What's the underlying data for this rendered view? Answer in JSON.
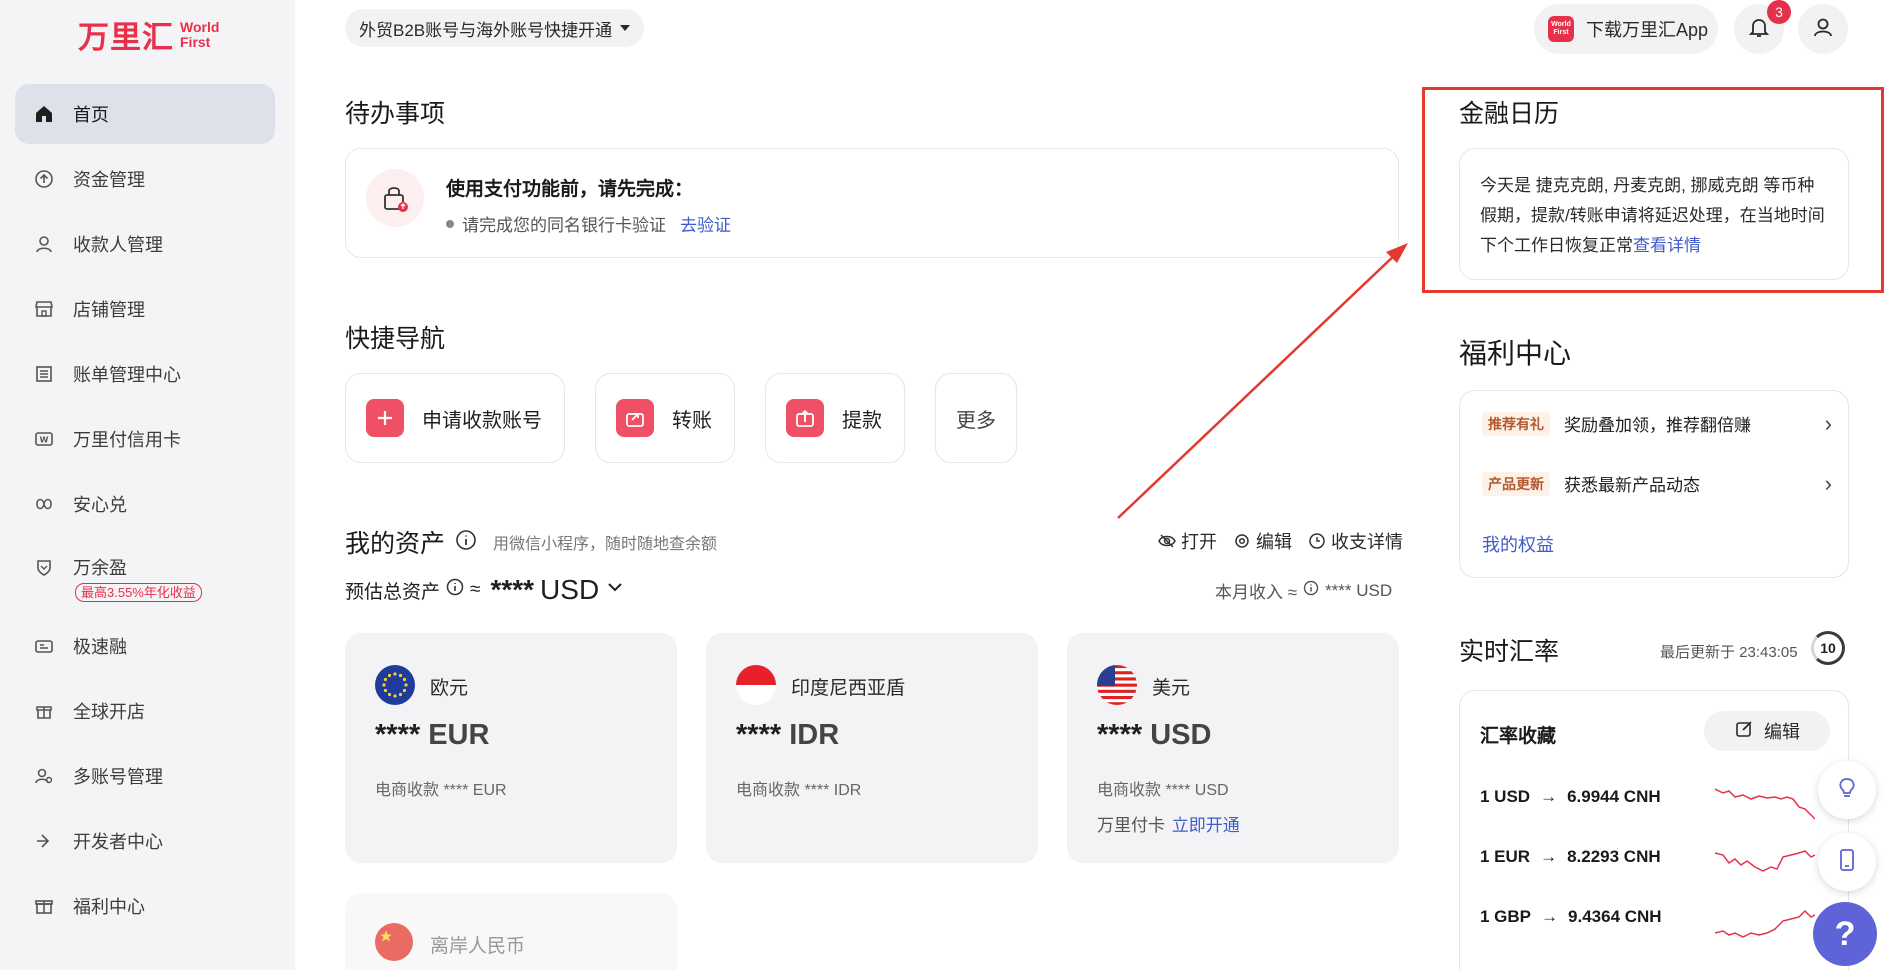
{
  "logo": {
    "cn": "万里汇",
    "en_line1": "World",
    "en_line2": "First"
  },
  "sidebar": {
    "items": [
      {
        "label": "首页",
        "icon": "home-icon",
        "active": true
      },
      {
        "label": "资金管理",
        "icon": "fund-icon"
      },
      {
        "label": "收款人管理",
        "icon": "payee-icon"
      },
      {
        "label": "店铺管理",
        "icon": "store-icon"
      },
      {
        "label": "账单管理中心",
        "icon": "bill-icon"
      },
      {
        "label": "万里付信用卡",
        "icon": "credit-card-icon"
      },
      {
        "label": "安心兑",
        "icon": "exchange-icon"
      },
      {
        "label": "万余盈",
        "icon": "wealth-icon",
        "badge": "最高3.55%年化收益"
      },
      {
        "label": "极速融",
        "icon": "finance-icon"
      },
      {
        "label": "全球开店",
        "icon": "global-store-icon"
      },
      {
        "label": "多账号管理",
        "icon": "multi-account-icon"
      },
      {
        "label": "开发者中心",
        "icon": "developer-icon"
      },
      {
        "label": "福利中心",
        "icon": "gift-icon"
      }
    ]
  },
  "topbar": {
    "account_switch": "外贸B2B账号与海外账号快捷开通",
    "download_app": "下载万里汇App",
    "app_logo_l1": "World",
    "app_logo_l2": "First",
    "notification_count": "3"
  },
  "todo": {
    "title": "待办事项",
    "heading": "使用支付功能前，请先完成：",
    "item": "请完成您的同名银行卡验证",
    "action": "去验证"
  },
  "quicknav": {
    "title": "快捷导航",
    "items": [
      "申请收款账号",
      "转账",
      "提款",
      "更多"
    ]
  },
  "assets": {
    "title": "我的资产",
    "subtitle": "用微信小程序，随时随地查余额",
    "tool_open": "打开",
    "tool_edit": "编辑",
    "tool_detail": "收支详情",
    "estimate_label": "预估总资产",
    "approx": "≈",
    "estimate_value": "****",
    "estimate_currency": "USD",
    "month_income": "本月收入 ≈",
    "month_value": "**** USD",
    "cards": [
      {
        "name": "欧元",
        "amount": "****",
        "code": "EUR",
        "sub": "电商收款 **** EUR"
      },
      {
        "name": "印度尼西亚盾",
        "amount": "****",
        "code": "IDR",
        "sub": "电商收款 **** IDR"
      },
      {
        "name": "美元",
        "amount": "****",
        "code": "USD",
        "sub": "电商收款 **** USD",
        "sub2_label": "万里付卡",
        "sub2_link": "立即开通"
      }
    ],
    "faded_card": "离岸人民币"
  },
  "calendar": {
    "title": "金融日历",
    "text": "今天是 捷克克朗, 丹麦克朗, 挪威克朗 等币种假期，提款/转账申请将延迟处理，在当地时间下个工作日恢复正常",
    "link": "查看详情"
  },
  "welfare": {
    "title": "福利中心",
    "rows": [
      {
        "tag": "推荐有礼",
        "text": "奖励叠加领，推荐翻倍赚"
      },
      {
        "tag": "产品更新",
        "text": "获悉最新产品动态"
      }
    ],
    "link": "我的权益"
  },
  "fx": {
    "title": "实时汇率",
    "updated": "最后更新于 23:43:05",
    "countdown": "10",
    "fav_title": "汇率收藏",
    "edit": "编辑",
    "rows": [
      {
        "from": "1 USD",
        "to": "6.9944 CNH"
      },
      {
        "from": "1 EUR",
        "to": "8.2293 CNH"
      },
      {
        "from": "1 GBP",
        "to": "9.4364 CNH"
      }
    ]
  },
  "colors": {
    "brand": "#e8304b",
    "link": "#3f5cc8",
    "highlight": "#e23a2e",
    "help": "#5f63d8"
  }
}
